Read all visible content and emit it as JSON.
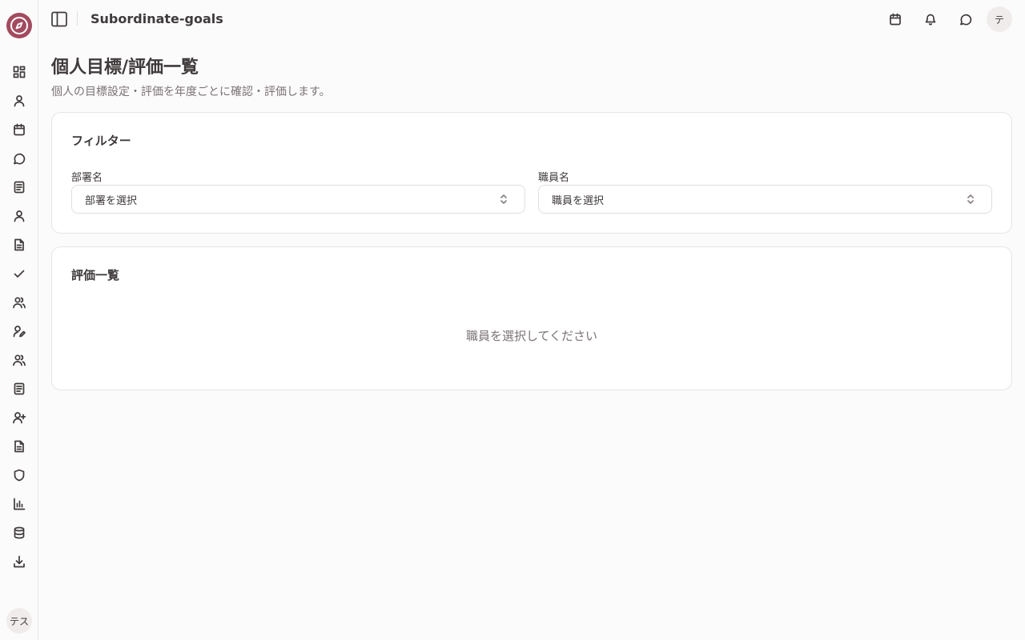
{
  "header": {
    "title": "Subordinate-goals",
    "avatar_initial": "テ"
  },
  "sidebar": {
    "user_initials": "テス",
    "items": [
      {
        "icon": "dashboard-icon"
      },
      {
        "icon": "user-icon"
      },
      {
        "icon": "calendar-icon"
      },
      {
        "icon": "chat-icon"
      },
      {
        "icon": "document-icon"
      },
      {
        "icon": "user-icon"
      },
      {
        "icon": "file-icon"
      },
      {
        "icon": "check-icon"
      },
      {
        "icon": "users-icon"
      },
      {
        "icon": "user-edit-icon"
      },
      {
        "icon": "users-icon"
      },
      {
        "icon": "document-icon"
      },
      {
        "icon": "user-plus-icon"
      },
      {
        "icon": "file-icon"
      },
      {
        "icon": "shield-icon"
      },
      {
        "icon": "bar-chart-icon"
      },
      {
        "icon": "database-icon"
      },
      {
        "icon": "download-icon"
      }
    ]
  },
  "page": {
    "title": "個人目標/評価一覧",
    "subtitle": "個人の目標設定・評価を年度ごとに確認・評価します。"
  },
  "filter": {
    "title": "フィルター",
    "department_label": "部署名",
    "department_value": "部署を選択",
    "staff_label": "職員名",
    "staff_value": "職員を選択"
  },
  "evaluation": {
    "title": "評価一覧",
    "empty_message": "職員を選択してください"
  },
  "colors": {
    "brand": "#a34b5e",
    "background": "#fcfbfb",
    "text": "#3f3a3b",
    "muted": "#7b7375"
  }
}
